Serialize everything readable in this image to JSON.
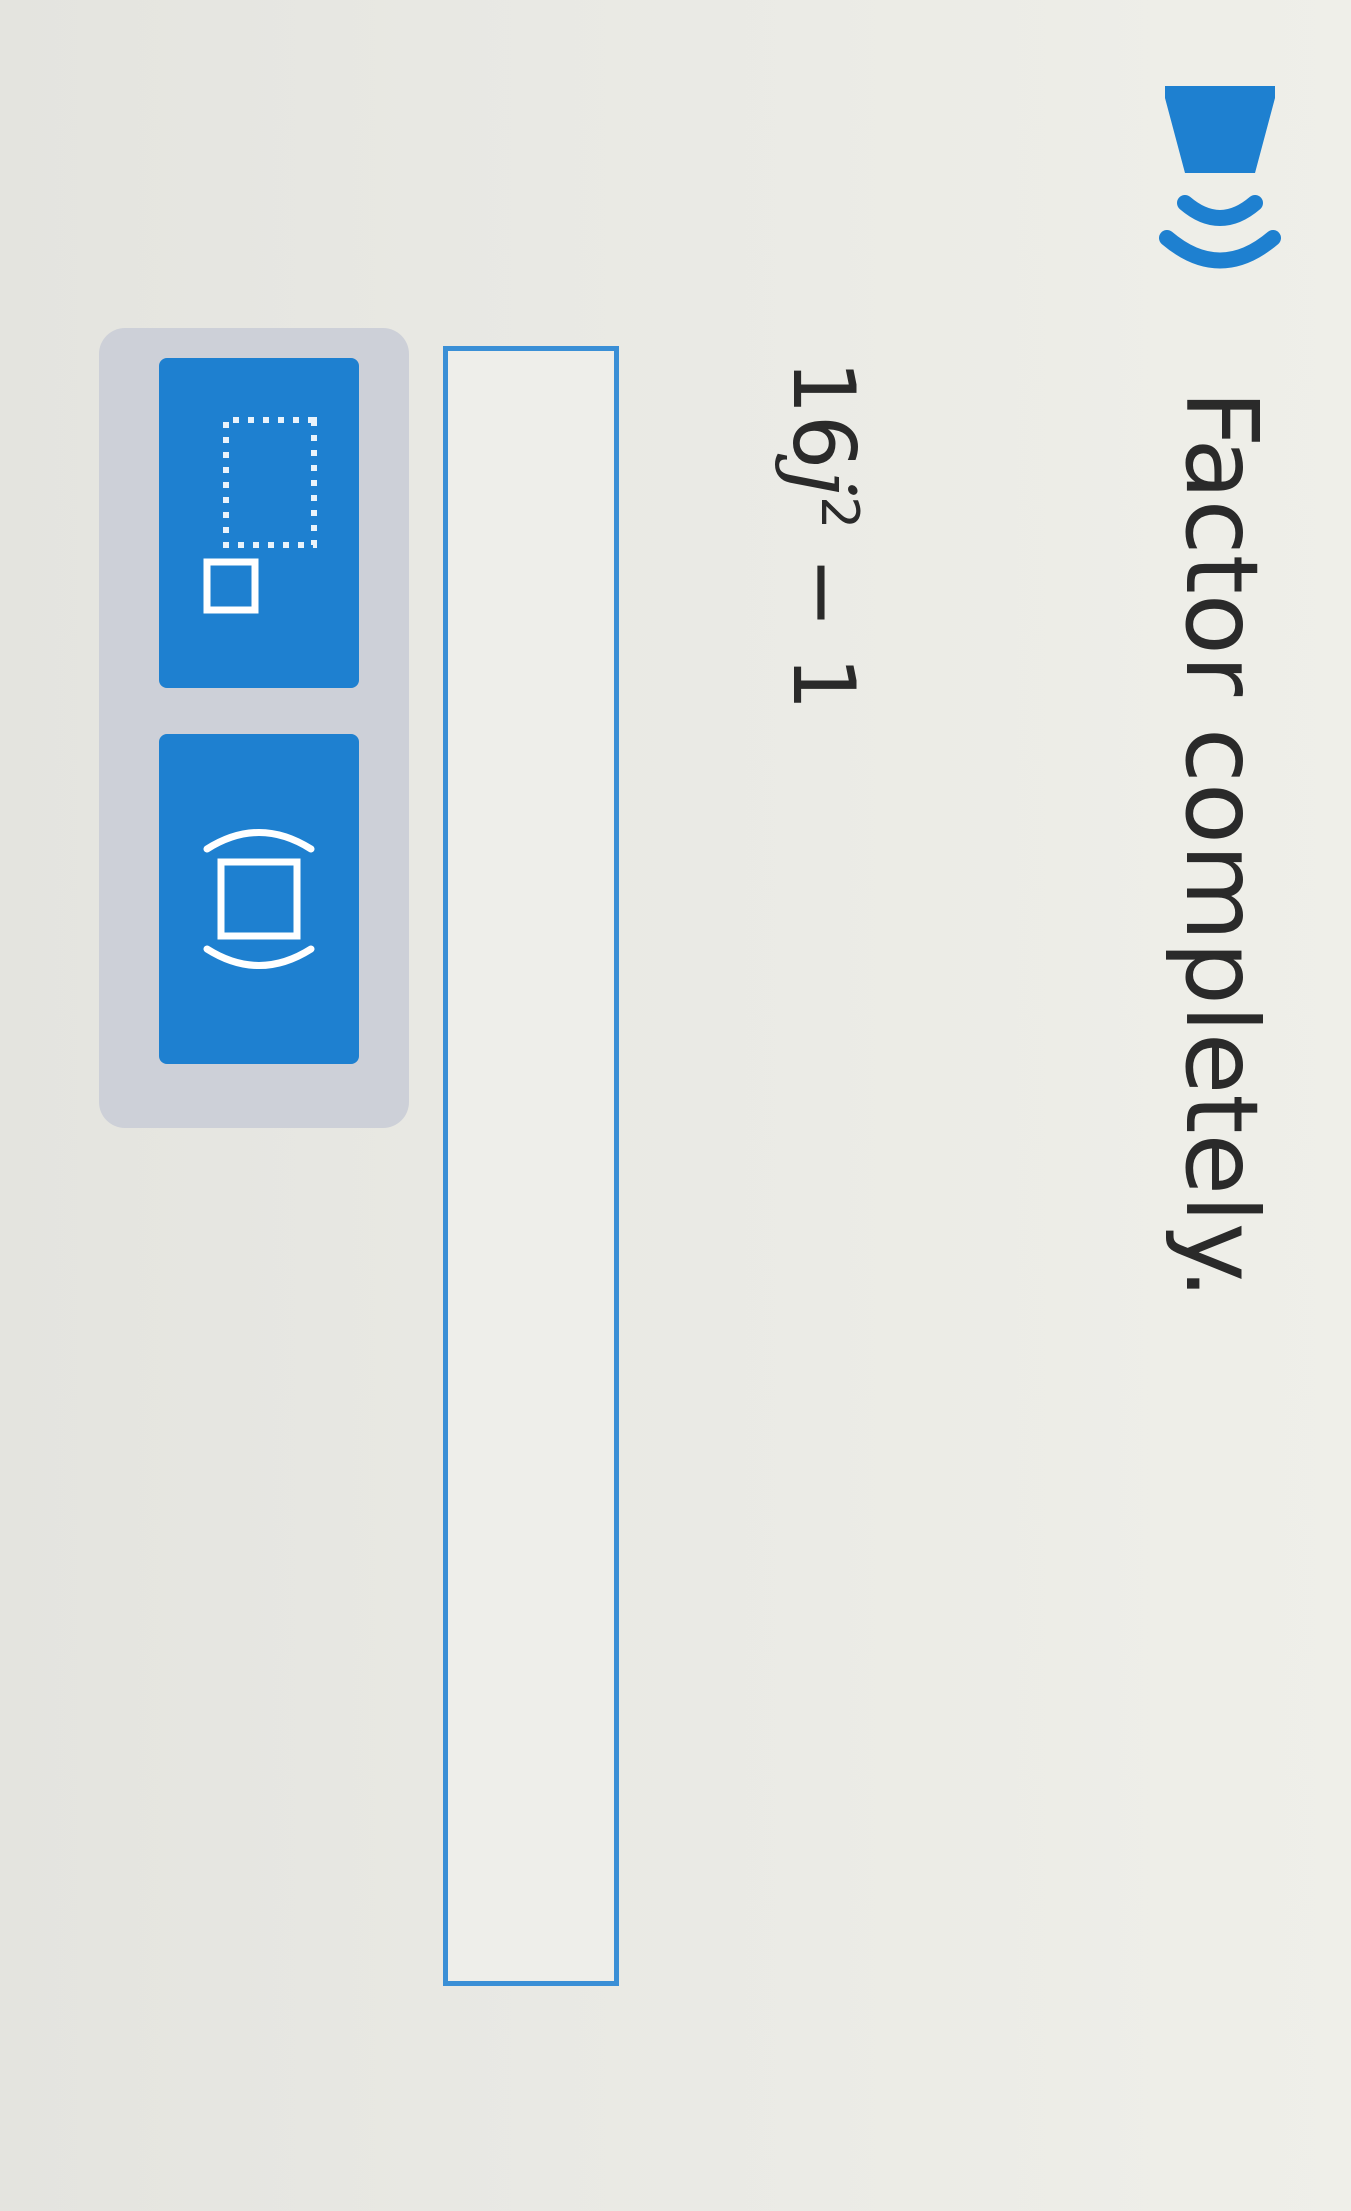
{
  "question": {
    "instruction": "Factor completely.",
    "expression": {
      "coefficient": "16",
      "variable": "j",
      "exponent": "2",
      "operator": " − ",
      "constant": "1"
    }
  },
  "answer": {
    "value": ""
  },
  "toolbar": {
    "buttons": [
      {
        "icon": "exponent-template-icon"
      },
      {
        "icon": "parentheses-template-icon"
      }
    ]
  },
  "colors": {
    "accent": "#1e80d0",
    "input_border": "#3a8fd6",
    "toolbar_bg": "#cdd0d8",
    "text": "#2a2a2a"
  }
}
